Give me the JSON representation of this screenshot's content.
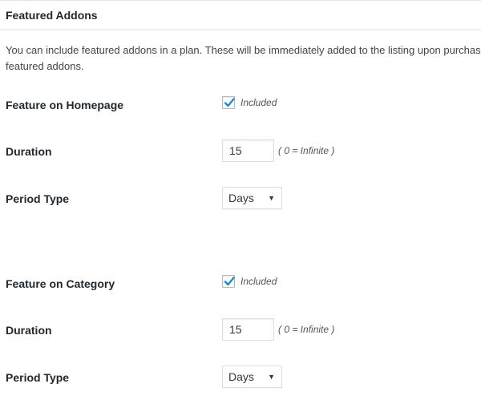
{
  "panel": {
    "title": "Featured Addons",
    "description": "You can include featured addons in a plan. These will be immediately added to the listing upon purchase. featured addons."
  },
  "groups": [
    {
      "feature": {
        "label": "Feature on Homepage",
        "checked": true,
        "check_label": "Included",
        "icon": "checkmark-icon"
      },
      "duration": {
        "label": "Duration",
        "value": "15",
        "hint": "( 0 = Infinite )"
      },
      "period": {
        "label": "Period Type",
        "selected": "Days",
        "arrow": "▼"
      }
    },
    {
      "feature": {
        "label": "Feature on Category",
        "checked": true,
        "check_label": "Included",
        "icon": "checkmark-icon"
      },
      "duration": {
        "label": "Duration",
        "value": "15",
        "hint": "( 0 = Infinite )"
      },
      "period": {
        "label": "Period Type",
        "selected": "Days",
        "arrow": "▼"
      }
    }
  ],
  "colors": {
    "check_accent": "#1e8cbe",
    "input_border": "#dddddd",
    "header_divider": "#eeeeee"
  }
}
